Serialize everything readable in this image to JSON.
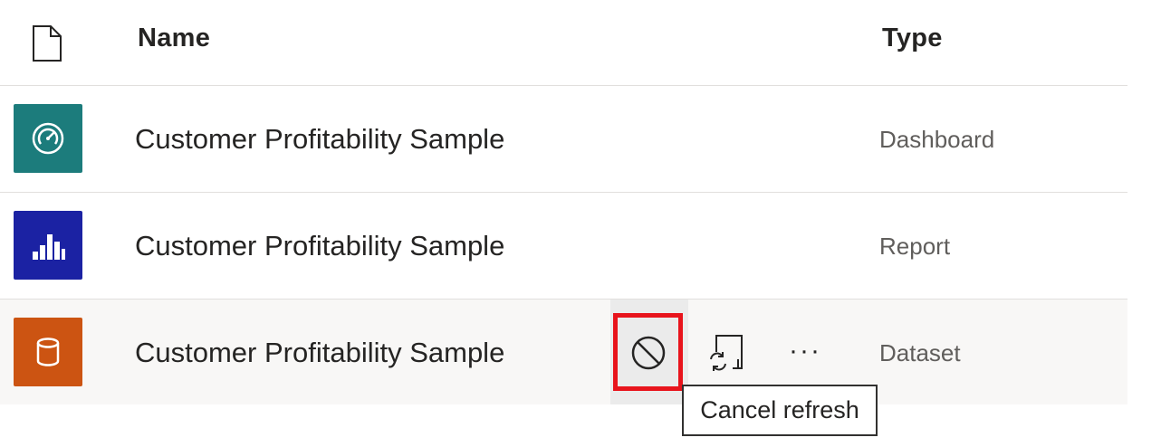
{
  "header": {
    "file_icon": "file-icon",
    "name_label": "Name",
    "type_label": "Type"
  },
  "rows": [
    {
      "name": "Customer Profitability Sample",
      "type": "Dashboard",
      "icon": "gauge-icon",
      "tile_color": "#1c7c7c"
    },
    {
      "name": "Customer Profitability Sample",
      "type": "Report",
      "icon": "bar-chart-icon",
      "tile_color": "#1b22a3"
    },
    {
      "name": "Customer Profitability Sample",
      "type": "Dataset",
      "icon": "database-icon",
      "tile_color": "#cc5412"
    }
  ],
  "actions": {
    "cancel_icon": "cancel-icon",
    "refresh_icon": "refresh-icon",
    "more_label": "···",
    "highlight_color": "#e8141c"
  },
  "tooltip": {
    "text": "Cancel refresh"
  }
}
